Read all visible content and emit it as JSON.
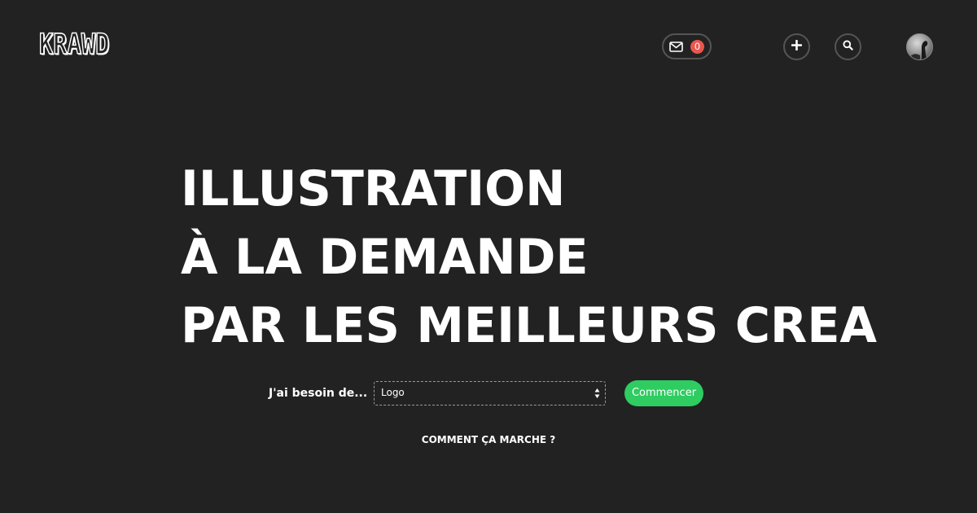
{
  "header": {
    "logo_text": "KRAWD",
    "messages_count": "0",
    "icons": {
      "messages": "envelope-icon",
      "add": "plus-icon",
      "search": "search-icon",
      "avatar": "user-avatar"
    }
  },
  "hero": {
    "lines": [
      "ILLUSTRATION",
      "À LA DEMANDE",
      "PAR LES MEILLEURS CREA"
    ]
  },
  "form": {
    "need_label": "J'ai besoin de...",
    "select_value": "Logo",
    "start_label": "Commencer"
  },
  "how_it_works_label": "COMMENT ÇA MARCHE ?",
  "colors": {
    "background": "#222222",
    "accent_green": "#2ecc61",
    "badge_red": "#e8574f",
    "text": "#ffffff"
  }
}
